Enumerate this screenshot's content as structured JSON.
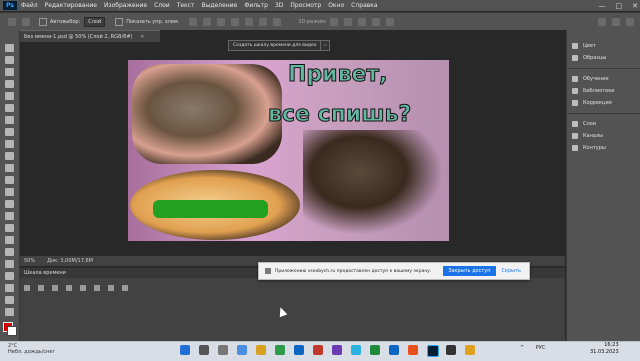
{
  "app": {
    "logo_text": "Ps"
  },
  "menu": [
    "Файл",
    "Редактирование",
    "Изображение",
    "Слои",
    "Текст",
    "Выделение",
    "Фильтр",
    "3D",
    "Просмотр",
    "Окно",
    "Справка"
  ],
  "window_controls": {
    "minimize": "—",
    "maximize": "□",
    "close": "✕"
  },
  "options": {
    "autoselect_label": "Автовыбор:",
    "layer_select_value": "Слой",
    "show_controls_label": "Показать упр. элем.",
    "mode_3d_label": "3D-режим:"
  },
  "document_tab": {
    "title": "Без имени-1.psd @ 50% (Слой 2, RGB/8#)",
    "close": "✕"
  },
  "image": {
    "headline_line1": "Привет,",
    "headline_line2": "все спишь?"
  },
  "statusbar": {
    "zoom": "50%",
    "doc_info": "Док: 3,00M/17,6M"
  },
  "timeline": {
    "title": "Шкала времени",
    "create_button": "Создать шкалу времени для видео",
    "dropdown_arrow": "⌵"
  },
  "share_notification": {
    "message": "Приложению vseobych.ru предоставлен доступ к вашему экрану.",
    "close_access": "Закрыть доступ",
    "hide": "Скрыть"
  },
  "right_panels": {
    "group1": [
      "Цвет",
      "Образцы"
    ],
    "group2": [
      "Обучение",
      "Библиотеки",
      "Коррекция"
    ],
    "group3": [
      "Слои",
      "Каналы",
      "Контуры"
    ]
  },
  "taskbar": {
    "weather_temp": "2°C",
    "weather_desc": "Небл. дождь/снег",
    "language": "РУС",
    "time": "16:23",
    "date": "31.03.2023"
  },
  "colors": {
    "foreground": "#d40000",
    "background": "#ffffff",
    "accent": "#31a8ff"
  }
}
